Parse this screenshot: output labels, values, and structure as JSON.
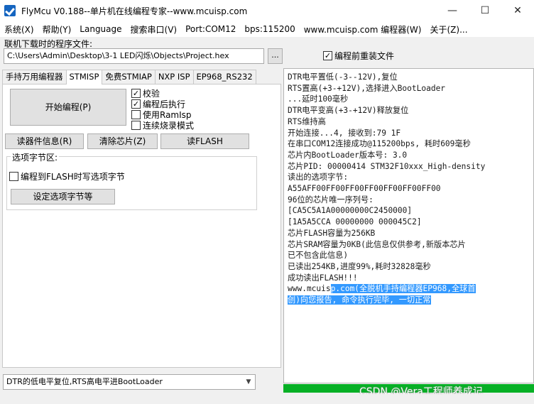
{
  "title": "FlyMcu V0.188--单片机在线编程专家--www.mcuisp.com",
  "window": {
    "minimize": "—",
    "maximize": "☐",
    "close": "✕"
  },
  "menu": [
    "系统(X)",
    "帮助(Y)",
    "Language",
    "搜索串口(V)",
    "Port:COM12",
    "bps:115200",
    "www.mcuisp.com 编程器(W)",
    "关于(Z)..."
  ],
  "file": {
    "label": "联机下载时的程序文件:",
    "path": "C:\\Users\\Admin\\Desktop\\3-1 LED闪烁\\Objects\\Project.hex",
    "browse": "...",
    "reload_label": "编程前重装文件",
    "reload_checked": "✓"
  },
  "tabs": [
    "手持万用编程器",
    "STMISP",
    "免费STMIAP",
    "NXP ISP",
    "EP968_RS232"
  ],
  "stmisp": {
    "start_button": "开始编程(P)",
    "options": [
      {
        "label": "校验",
        "mark": "✓"
      },
      {
        "label": "编程后执行",
        "mark": "✓"
      },
      {
        "label": "使用RamIsp",
        "mark": ""
      },
      {
        "label": "连续烧录模式",
        "mark": ""
      }
    ],
    "read_info": "读器件信息(R)",
    "erase": "清除芯片(Z)",
    "read_flash": "读FLASH",
    "option_group": {
      "label": "选项字节区:",
      "checkbox": "编程到FLASH时写选项字节",
      "mark": "",
      "set_button": "设定选项字节等"
    }
  },
  "dtr_mode": "DTR的低电平复位,RTS高电平进BootLoader",
  "log": [
    "DTR电平置低(-3--12V),复位",
    "RTS置高(+3-+12V),选择进入BootLoader",
    "...延时100毫秒",
    "DTR电平变高(+3-+12V)释放复位",
    "RTS维持高",
    "开始连接...4, 接收到:79 1F",
    "在串口COM12连接成功@115200bps, 耗时609毫秒",
    "芯片内BootLoader版本号: 3.0",
    "芯片PID: 00000414  STM32F10xxx_High-density",
    "读出的选项字节:",
    "A55AFF00FF00FF00FF00FF00FF00FF00",
    "96位的芯片唯一序列号:",
    "[CA5C5A1A00000000C2450000]",
    "[1A5A5CCA 00000000 000045C2]",
    "芯片FLASH容量为256KB",
    "芯片SRAM容量为0KB(此信息仅供参考,新版本芯片",
    "已不包含此信息)",
    "已读出254KB,进度99%,耗时32828毫秒",
    "成功读出FLASH!!!"
  ],
  "log_tail": {
    "prefix": "www.mcuis",
    "highlighted_1": "p.com(全脱机手持编程器EP968,全球首",
    "highlighted_2": "创)向您报告, 命令执行完毕, 一切正常"
  },
  "progress_percent": 100,
  "watermark": "CSDN @Vera工程师养成记",
  "colors": {
    "highlight": "#3399ff",
    "progress": "#06b025"
  }
}
